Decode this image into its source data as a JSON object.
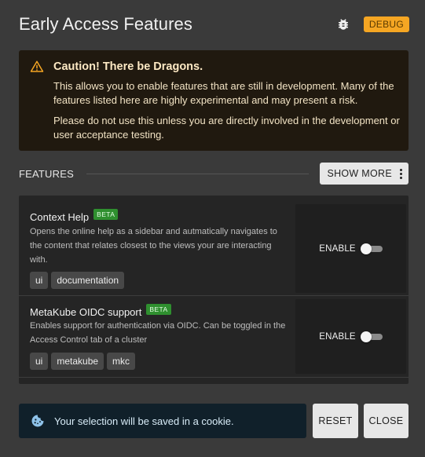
{
  "dialog": {
    "title": "Early Access Features",
    "debug_badge": "DEBUG",
    "icons": {
      "bug": "bug-icon"
    }
  },
  "caution": {
    "icon": "warning-triangle-icon",
    "title": "Caution! There be Dragons.",
    "paragraph1": "This allows you to enable features that are still in development. Many of the features listed here are highly experimental and may present a risk.",
    "paragraph2": "Please do not use this unless you are directly involved in the development or user acceptance testing."
  },
  "features": {
    "label": "FEATURES",
    "show_more": "SHOW MORE",
    "items": [
      {
        "title": "Context Help",
        "badge": "BETA",
        "description": "Opens the online help as a sidebar and autmatically navigates to the content that relates closest to the views your are interacting with.",
        "tags": [
          "ui",
          "documentation"
        ],
        "toggle_label": "ENABLE",
        "enabled": false
      },
      {
        "title": "MetaKube OIDC support",
        "badge": "BETA",
        "description": "Enables support for authentication via OIDC. Can be toggled in the Access Control tab of a cluster",
        "tags": [
          "ui",
          "metakube",
          "mkc"
        ],
        "toggle_label": "ENABLE",
        "enabled": false
      }
    ]
  },
  "footer": {
    "cookie_icon": "cookie-icon",
    "notice": "Your selection will be saved in a cookie.",
    "reset_label": "RESET",
    "close_label": "CLOSE"
  },
  "colors": {
    "background": "#3a3a3a",
    "caution_bg": "#20190f",
    "debug_badge": "#f5a623",
    "beta_badge": "#2f8f2f",
    "notice_bg": "#10202a"
  }
}
